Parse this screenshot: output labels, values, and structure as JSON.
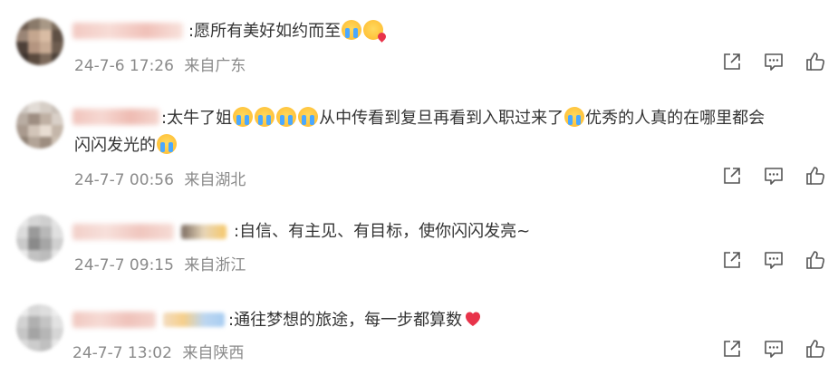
{
  "comments": [
    {
      "text": ":愿所有美好如约而至",
      "time": "24-7-6 17:26",
      "location": "来自广东",
      "emojis": [
        "cry",
        "kiss"
      ]
    },
    {
      "text_a": ":太牛了姐",
      "text_b": "从中传看到复旦再看到入职过来了",
      "text_c": "优秀的人真的在哪里都会",
      "text_d": "闪闪发光的",
      "time": "24-7-7 00:56",
      "location": "来自湖北"
    },
    {
      "text": ":自信、有主见、有目标，使你闪闪发亮~",
      "time": "24-7-7 09:15",
      "location": "来自浙江"
    },
    {
      "text": ":通往梦想的旅途，每一步都算数",
      "time": "24-7-7 13:02",
      "location": "来自陕西"
    }
  ],
  "icons": {
    "share": "share-icon",
    "comment": "comment-icon",
    "like": "like-icon"
  },
  "colors": {
    "text": "#333333",
    "meta": "#8a8a8a",
    "icon": "#555555",
    "heart": "#e8334a"
  }
}
